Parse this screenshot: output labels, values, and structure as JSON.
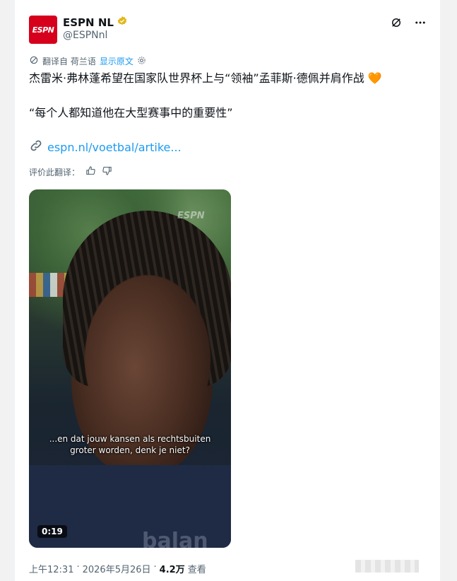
{
  "author": {
    "display_name": "ESPN NL",
    "handle": "@ESPNnl",
    "logo_text": "ESPN"
  },
  "translation": {
    "translated_from": "翻译自 荷兰语",
    "show_original": "显示原文"
  },
  "tweet": {
    "text": "杰雷米·弗林蓬希望在国家队世界杯上与“领袖”孟菲斯·德佩并肩作战",
    "emoji": "🧡",
    "quote": "“每个人都知道他在大型赛事中的重要性”",
    "link": "espn.nl/voetbal/artike..."
  },
  "rate_translation": {
    "label": "评价此翻译："
  },
  "video": {
    "subtitle_line1": "...en dat jouw kansen als rechtsbuiten",
    "subtitle_line2": "groter worden, denk je niet?",
    "duration": "0:19",
    "watermark": "ESPN",
    "shirt_text": "balan"
  },
  "meta": {
    "time": "上午12:31",
    "sep1": "·",
    "date": "2026年5月26日",
    "sep2": "·",
    "views": "4.2万",
    "views_label": "查看"
  },
  "icons": {
    "verified": "verified-badge-icon",
    "grok": "grok-icon",
    "more": "more-icon",
    "translate": "translate-icon",
    "settings": "gear-icon",
    "link": "link-icon",
    "thumbs_up": "thumbs-up-icon",
    "thumbs_down": "thumbs-down-icon"
  },
  "colors": {
    "espn_red": "#d6001c",
    "link_blue": "#1d9bf0",
    "verified_gold": "#e2b719",
    "secondary_text": "#536471"
  }
}
